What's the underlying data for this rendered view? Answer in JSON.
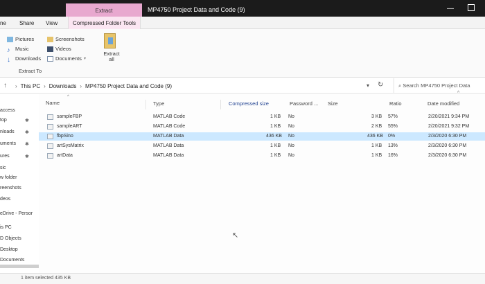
{
  "window": {
    "title": "MP4750 Project Data and Code (9)",
    "context_tab": "Extract",
    "minimize": "—"
  },
  "ribbon_tabs": {
    "share": "Share",
    "view": "View",
    "tools": "Compressed Folder Tools",
    "partial_left": "ne"
  },
  "ribbon": {
    "items": [
      {
        "label": "Pictures",
        "icon": "pictures-icon"
      },
      {
        "label": "Music",
        "icon": "music-icon"
      },
      {
        "label": "Downloads",
        "icon": "downloads-icon"
      },
      {
        "label": "Screenshots",
        "icon": "folder-icon"
      },
      {
        "label": "Videos",
        "icon": "videos-icon"
      },
      {
        "label": "Documents",
        "icon": "documents-icon"
      }
    ],
    "extract_all": "Extract all",
    "group_label": "Extract To"
  },
  "address": {
    "crumbs": [
      "This PC",
      "Downloads",
      "MP4750 Project Data and Code (9)"
    ],
    "search_placeholder": "Search MP4750 Project Data"
  },
  "nav_pane": {
    "items": [
      "access",
      "top",
      "nloads",
      "uments",
      "ures",
      "sic",
      "w folder",
      "reenshots",
      "deos",
      "eDrive - Persor",
      "is PC",
      "D Objects",
      "Desktop",
      "Documents"
    ]
  },
  "columns": {
    "name": "Name",
    "type": "Type",
    "compressed_size": "Compressed size",
    "password": "Password ...",
    "size": "Size",
    "ratio": "Ratio",
    "date_modified": "Date modified"
  },
  "files": [
    {
      "name": "sampleFBP",
      "type": "MATLAB Code",
      "compressed": "1 KB",
      "password": "No",
      "size": "3 KB",
      "ratio": "57%",
      "date": "2/20/2021 9:34 PM",
      "selected": false
    },
    {
      "name": "sampleART",
      "type": "MATLAB Code",
      "compressed": "1 KB",
      "password": "No",
      "size": "2 KB",
      "ratio": "55%",
      "date": "2/20/2021 9:32 PM",
      "selected": false
    },
    {
      "name": "fbpSino",
      "type": "MATLAB Data",
      "compressed": "436 KB",
      "password": "No",
      "size": "436 KB",
      "ratio": "0%",
      "date": "2/3/2020 6:30 PM",
      "selected": true
    },
    {
      "name": "artSysMatrix",
      "type": "MATLAB Data",
      "compressed": "1 KB",
      "password": "No",
      "size": "1 KB",
      "ratio": "13%",
      "date": "2/3/2020 6:30 PM",
      "selected": false
    },
    {
      "name": "artData",
      "type": "MATLAB Data",
      "compressed": "1 KB",
      "password": "No",
      "size": "1 KB",
      "ratio": "16%",
      "date": "2/3/2020 6:30 PM",
      "selected": false
    }
  ],
  "status": {
    "text": "1 item selected 435 KB"
  }
}
